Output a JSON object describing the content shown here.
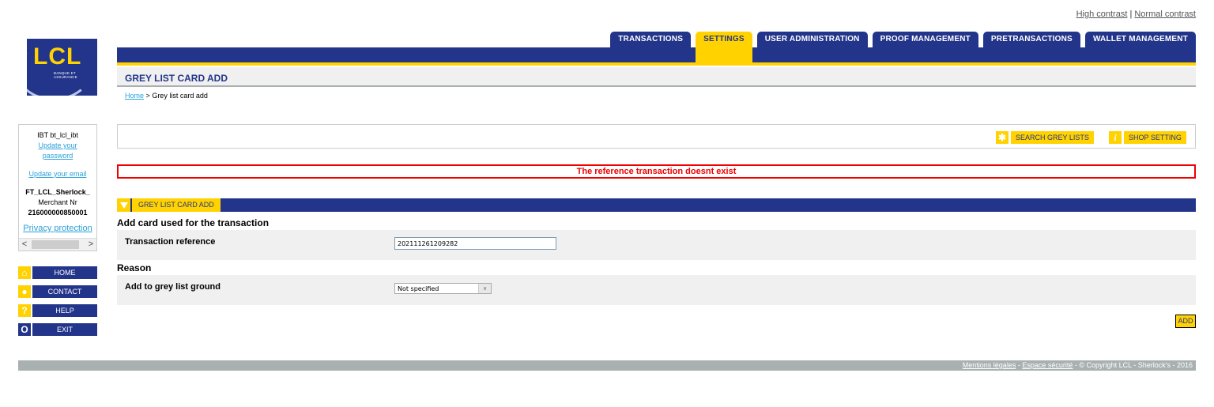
{
  "contrast": {
    "high": "High contrast",
    "separator": "|",
    "normal": "Normal contrast"
  },
  "logo": {
    "brand": "LCL",
    "tagline": "BANQUE ET ASSURANCE"
  },
  "tabs": [
    {
      "label": "TRANSACTIONS",
      "active": false
    },
    {
      "label": "SETTINGS",
      "active": true
    },
    {
      "label": "USER ADMINISTRATION",
      "active": false
    },
    {
      "label": "PROOF MANAGEMENT",
      "active": false
    },
    {
      "label": "PRETRANSACTIONS",
      "active": false
    },
    {
      "label": "WALLET MANAGEMENT",
      "active": false
    }
  ],
  "page": {
    "title": "GREY LIST CARD ADD"
  },
  "breadcrumb": {
    "home": "Home",
    "separator": ">",
    "current": "Grey list card add"
  },
  "user": {
    "name": "IBT bt_lcl_ibt",
    "update_password_1": "Update your",
    "update_password_2": "password",
    "update_email": "Update your email",
    "shop": "FT_LCL_Sherlock_",
    "merchant_label": "Merchant Nr",
    "merchant_nr": "216000000850001",
    "privacy": "Privacy protection"
  },
  "side_menu": [
    {
      "label": "HOME",
      "icon": "home-icon",
      "glyph": "⌂"
    },
    {
      "label": "CONTACT",
      "icon": "speech-bubble-icon",
      "glyph": "●"
    },
    {
      "label": "HELP",
      "icon": "question-icon",
      "glyph": "?"
    },
    {
      "label": "EXIT",
      "icon": "power-icon",
      "glyph": "O"
    }
  ],
  "actions": {
    "search": {
      "label": "SEARCH GREY LISTS",
      "icon": "walking-man-icon",
      "glyph": "🚶"
    },
    "shop_setting": {
      "label": "SHOP SETTING",
      "icon": "info-icon",
      "glyph": "i"
    }
  },
  "error_message": "The reference transaction doesnt exist",
  "section": {
    "label": "GREY LIST CARD ADD"
  },
  "form": {
    "group1_title": "Add card used for the transaction",
    "transaction_reference_label": "Transaction reference",
    "transaction_reference_value": "202111261209282",
    "group2_title": "Reason",
    "ground_label": "Add to grey list ground",
    "ground_value": "Not specified",
    "add_button": "ADD"
  },
  "footer": {
    "legal": "Mentions légales",
    "security": "Espace sécurité",
    "copyright": "- © Copyright LCL - Sherlock's - 2016",
    "sep": "-"
  },
  "colors": {
    "brand_blue": "#23358a",
    "brand_yellow": "#ffd200",
    "error_red": "#e00000"
  }
}
